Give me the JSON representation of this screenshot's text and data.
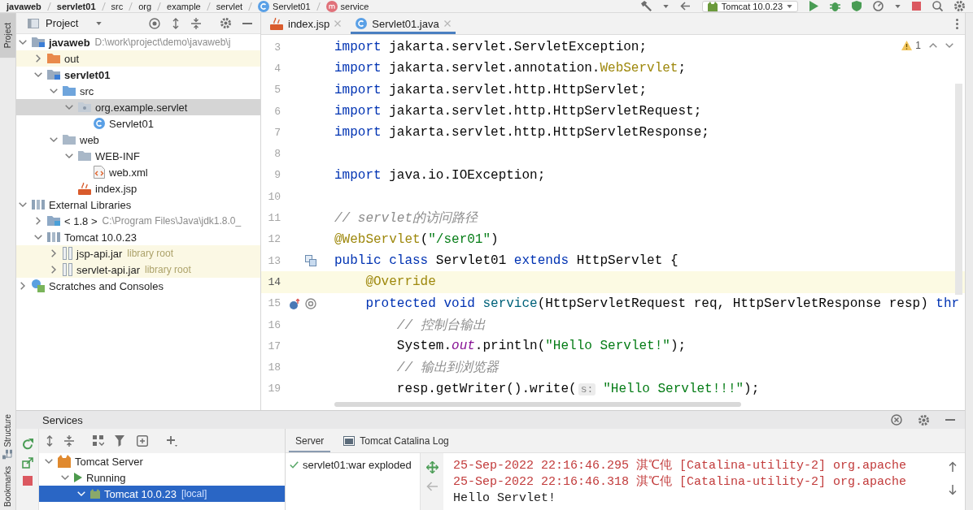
{
  "nav_bar": {
    "breadcrumbs": [
      {
        "label": "javaweb",
        "kind": "module"
      },
      {
        "label": "servlet01",
        "kind": "module"
      },
      {
        "label": "src",
        "kind": "folder"
      },
      {
        "label": "org",
        "kind": "package"
      },
      {
        "label": "example",
        "kind": "package"
      },
      {
        "label": "servlet",
        "kind": "package"
      },
      {
        "label": "Servlet01",
        "kind": "class"
      },
      {
        "label": "service",
        "kind": "method"
      }
    ],
    "run_config": "Tomcat 10.0.23"
  },
  "tool_windows": {
    "top": [
      {
        "label": "Project",
        "selected": true
      }
    ],
    "bottom": [
      {
        "label": "Structure",
        "kind": "structure",
        "selected": false
      },
      {
        "label": "Bookmarks",
        "selected": false
      }
    ]
  },
  "project": {
    "title": "Project",
    "tree": [
      {
        "label": "javaweb",
        "hint": "D:\\work\\project\\demo\\javaweb\\j",
        "kind": "module",
        "expanded": true,
        "selected": false,
        "children": [
          {
            "label": "out",
            "kind": "excluded",
            "expanded": false,
            "selected": false
          },
          {
            "label": "servlet01",
            "kind": "module",
            "expanded": true,
            "selected": false,
            "children": [
              {
                "label": "src",
                "kind": "source",
                "expanded": true,
                "selected": false,
                "children": [
                  {
                    "label": "org.example.servlet",
                    "kind": "package",
                    "expanded": true,
                    "selected": true,
                    "children": [
                      {
                        "label": "Servlet01",
                        "kind": "class",
                        "selected": false
                      }
                    ]
                  }
                ]
              },
              {
                "label": "web",
                "kind": "folder",
                "expanded": true,
                "selected": false,
                "children": [
                  {
                    "label": "WEB-INF",
                    "kind": "folder",
                    "expanded": true,
                    "selected": false,
                    "children": [
                      {
                        "label": "web.xml",
                        "kind": "xml",
                        "selected": false
                      }
                    ]
                  },
                  {
                    "label": "index.jsp",
                    "kind": "jsp",
                    "selected": false
                  }
                ]
              }
            ]
          }
        ]
      },
      {
        "label": "External Libraries",
        "kind": "libraries",
        "expanded": true,
        "selected": false,
        "children": [
          {
            "label": "< 1.8 >",
            "hint": "C:\\Program Files\\Java\\jdk1.8.0_",
            "kind": "sdk",
            "expanded": false,
            "selected": false
          },
          {
            "label": "Tomcat 10.0.23",
            "kind": "libraries",
            "expanded": true,
            "selected": false,
            "children": [
              {
                "label": "jsp-api.jar",
                "hint": "library root",
                "kind": "jar",
                "expanded": false,
                "selected": false
              },
              {
                "label": "servlet-api.jar",
                "hint": "library root",
                "kind": "jar",
                "expanded": false,
                "selected": false
              }
            ]
          }
        ]
      },
      {
        "label": "Scratches and Consoles",
        "kind": "scratches",
        "expanded": false,
        "selected": false
      }
    ]
  },
  "editor": {
    "tabs": [
      {
        "label": "index.jsp",
        "kind": "jsp",
        "selected": false
      },
      {
        "label": "Servlet01.java",
        "kind": "class",
        "selected": true
      }
    ],
    "warnings": "1",
    "lines": [
      {
        "number": "3",
        "current": false,
        "tokens": [
          {
            "text": "import",
            "kind": "keyword"
          },
          {
            "text": " jakarta.servlet.ServletException;",
            "kind": "plain"
          }
        ]
      },
      {
        "number": "4",
        "current": false,
        "tokens": [
          {
            "text": "import",
            "kind": "keyword"
          },
          {
            "text": " jakarta.servlet.annotation.",
            "kind": "plain"
          },
          {
            "text": "WebServlet",
            "kind": "annotation"
          },
          {
            "text": ";",
            "kind": "plain"
          }
        ]
      },
      {
        "number": "5",
        "current": false,
        "tokens": [
          {
            "text": "import",
            "kind": "keyword"
          },
          {
            "text": " jakarta.servlet.http.HttpServlet;",
            "kind": "plain"
          }
        ]
      },
      {
        "number": "6",
        "current": false,
        "tokens": [
          {
            "text": "import",
            "kind": "keyword"
          },
          {
            "text": " jakarta.servlet.http.HttpServletRequest;",
            "kind": "plain"
          }
        ]
      },
      {
        "number": "7",
        "current": false,
        "tokens": [
          {
            "text": "import",
            "kind": "keyword"
          },
          {
            "text": " jakarta.servlet.http.HttpServletResponse;",
            "kind": "plain"
          }
        ]
      },
      {
        "number": "8",
        "current": false
      },
      {
        "number": "9",
        "current": false,
        "tokens": [
          {
            "text": "import",
            "kind": "keyword"
          },
          {
            "text": " java.io.IOException;",
            "kind": "plain"
          }
        ]
      },
      {
        "number": "10",
        "current": false
      },
      {
        "number": "11",
        "current": false,
        "tokens": [
          {
            "text": "// servlet的访问路径",
            "kind": "comment"
          }
        ]
      },
      {
        "number": "12",
        "current": false,
        "tokens": [
          {
            "text": "@WebServlet",
            "kind": "annotation"
          },
          {
            "text": "(",
            "kind": "plain"
          },
          {
            "text": "\"/ser01\"",
            "kind": "string"
          },
          {
            "text": ")",
            "kind": "plain"
          }
        ]
      },
      {
        "number": "13",
        "current": false,
        "markers": [
          {
            "kind": "implemented"
          }
        ],
        "tokens": [
          {
            "text": "public class",
            "kind": "keyword"
          },
          {
            "text": " Servlet01 ",
            "kind": "plain"
          },
          {
            "text": "extends",
            "kind": "keyword"
          },
          {
            "text": " HttpServlet {",
            "kind": "plain"
          }
        ]
      },
      {
        "number": "14",
        "current": true,
        "tokens": [
          {
            "text": "    @Override",
            "kind": "annotation"
          }
        ]
      },
      {
        "number": "15",
        "current": false,
        "markers": [
          {
            "kind": "overrides"
          },
          {
            "kind": "annotated"
          }
        ],
        "tokens": [
          {
            "text": "    protected void ",
            "kind": "keyword"
          },
          {
            "text": "service",
            "kind": "method"
          },
          {
            "text": "(HttpServletRequest req, HttpServletResponse resp) ",
            "kind": "plain"
          },
          {
            "text": "thr",
            "kind": "keyword"
          }
        ]
      },
      {
        "number": "16",
        "current": false,
        "tokens": [
          {
            "text": "        // 控制台输出",
            "kind": "comment"
          }
        ]
      },
      {
        "number": "17",
        "current": false,
        "tokens": [
          {
            "text": "        System.",
            "kind": "plain"
          },
          {
            "text": "out",
            "kind": "field"
          },
          {
            "text": ".println(",
            "kind": "plain"
          },
          {
            "text": "\"Hello Servlet!\"",
            "kind": "string"
          },
          {
            "text": ");",
            "kind": "plain"
          }
        ]
      },
      {
        "number": "18",
        "current": false,
        "tokens": [
          {
            "text": "        // 输出到浏览器",
            "kind": "comment"
          }
        ]
      },
      {
        "number": "19",
        "current": false,
        "tokens": [
          {
            "text": "        resp.getWriter().write(",
            "kind": "plain"
          },
          {
            "text": "s:",
            "kind": "hint"
          },
          {
            "text": "\"Hello Servlet!!!\"",
            "kind": "string"
          },
          {
            "text": ");",
            "kind": "plain"
          }
        ]
      }
    ]
  },
  "services": {
    "title": "Services",
    "tree": [
      {
        "label": "Tomcat Server",
        "kind": "server",
        "expanded": true,
        "selected": false,
        "children": [
          {
            "label": "Running",
            "kind": "running",
            "expanded": true,
            "selected": false,
            "children": [
              {
                "label": "Tomcat 10.0.23",
                "hint": "[local]",
                "kind": "instance",
                "expanded": true,
                "selected": true
              }
            ]
          }
        ]
      }
    ],
    "tabs": [
      {
        "label": "Server",
        "selected": true
      },
      {
        "label": "Tomcat Catalina Log",
        "kind": "log",
        "selected": false
      }
    ],
    "deployments": [
      {
        "label": "servlet01:war exploded",
        "deployed": true
      }
    ],
    "console": [
      {
        "text": "25-Sep-2022 22:16:46.295 淇℃伅 [Catalina-utility-2] org.apache",
        "kind": "error"
      },
      {
        "text": "25-Sep-2022 22:16:46.318 淇℃伅 [Catalina-utility-2] org.apache",
        "kind": "error"
      },
      {
        "text": "Hello Servlet!",
        "kind": "output"
      }
    ]
  }
}
